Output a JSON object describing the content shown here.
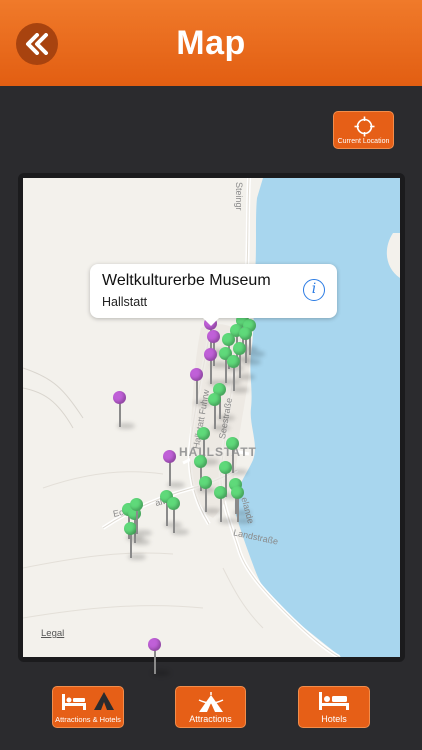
{
  "header": {
    "title": "Map",
    "back_icon": "double-chevron-left-icon",
    "color": "#e8661c"
  },
  "current_location": {
    "label": "Current Location",
    "icon": "crosshair-icon"
  },
  "map": {
    "callout": {
      "title": "Weltkulturerbe Museum",
      "subtitle": "Hallstatt",
      "info_icon": "info-icon"
    },
    "town_label": "HALLSTATT",
    "street_labels": [
      "Steingr",
      "Hallstatt Fuhrw",
      "Seestraße",
      "Ec",
      "alwe",
      "Landstraße",
      "elande"
    ],
    "legal": "Legal",
    "pin_colors": {
      "attractions": "#5fd97a",
      "selected": "#c060d8"
    }
  },
  "tabs": [
    {
      "label": "Attractions & Hotels",
      "icon": "bed-and-tent-icon"
    },
    {
      "label": "Attractions",
      "icon": "tent-icon"
    },
    {
      "label": "Hotels",
      "icon": "bed-icon"
    }
  ]
}
